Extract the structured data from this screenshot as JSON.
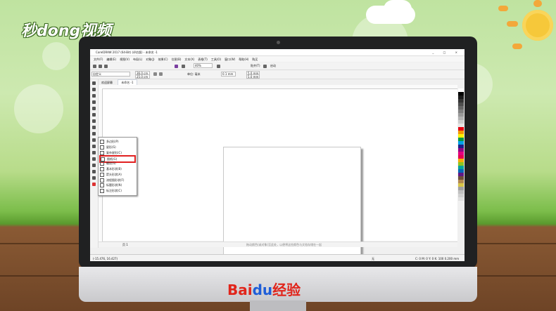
{
  "watermark": {
    "logo_text": "秒dong视频"
  },
  "monitor": {
    "brand_baidu": "Bai",
    "brand_du": "du",
    "brand_jingyan": "经验"
  },
  "app": {
    "title": "CorelDRAW 2017 (64-Bit) (评估版) - 未命名 -1",
    "window_controls": "_ □ ×",
    "menu": [
      "文件(F)",
      "编辑(E)",
      "视图(V)",
      "布局(L)",
      "对象(J)",
      "效果(C)",
      "位图(B)",
      "文本(X)",
      "表格(T)",
      "工具(O)",
      "窗口(W)",
      "帮助(H)",
      "购买"
    ],
    "zoom": "40%",
    "snap_label": "贴齐(T)",
    "launch_label": "启动",
    "page_size": "自定义",
    "width": "36.0 cm",
    "height": "25.0 cm",
    "units_label": "单位: 毫米",
    "nudge": "0.1 mm",
    "dup_x": "5.0 mm",
    "dup_y": "5.0 mm",
    "tabs": [
      "欢迎屏幕",
      "未命名 -1"
    ],
    "page_tab": "页 1",
    "hint": "拖动颜色(或对象)至此处，以便将这些颜色与文档存储在一起",
    "coords": "(-15.476, 16.427)",
    "fill_status": "无",
    "outline_status": "C: 0 M: 0 Y: 0 K: 100  0.200 mm"
  },
  "flyout": {
    "items": [
      "多边形(P)",
      "星形(S)",
      "复杂星形(C)",
      "图纸(G)",
      "螺纹(S)",
      "基本形状(B)",
      "箭头形状(A)",
      "流程图形状(F)",
      "标题形状(N)",
      "标注形状(C)"
    ],
    "selected_index": 3
  },
  "palette": [
    "#ffffff",
    "#000000",
    "#1a1a1a",
    "#333333",
    "#4d4d4d",
    "#666666",
    "#808080",
    "#999999",
    "#b3b3b3",
    "#cccccc",
    "#e6e6e6",
    "#e60012",
    "#f39800",
    "#fff100",
    "#009944",
    "#00a0e9",
    "#1d2088",
    "#920783",
    "#e4007f",
    "#e5004f",
    "#f6ab00",
    "#8fc31f",
    "#00a29a",
    "#0068b7",
    "#601986",
    "#6f4f3a",
    "#b28850",
    "#d7c447",
    "#a0a0a0",
    "#c0c0c0",
    "#d0d0d0",
    "#e0e0e0",
    "#f0f0f0"
  ]
}
